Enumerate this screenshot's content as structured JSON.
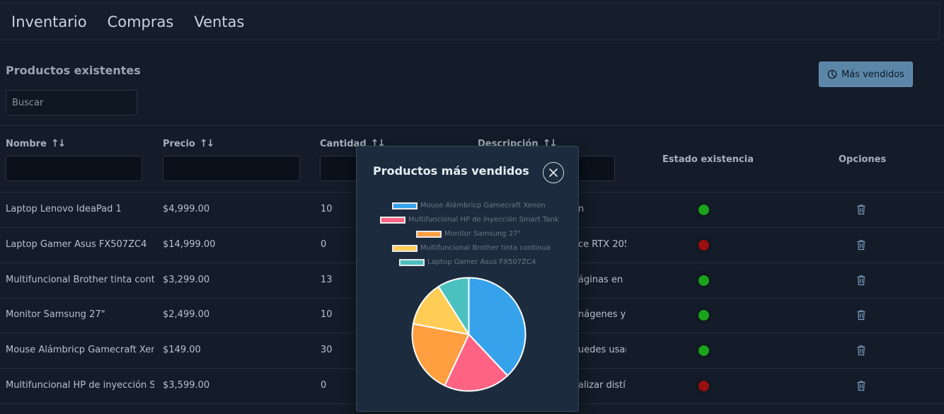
{
  "nav": {
    "items": [
      "Inventario",
      "Compras",
      "Ventas"
    ]
  },
  "page": {
    "title": "Productos existentes",
    "search_placeholder": "Buscar",
    "top_button": "Más vendidos"
  },
  "table": {
    "headers": [
      "Nombre",
      "Precio",
      "Cantidad",
      "Descripción",
      "Estado existencia",
      "Opciones"
    ],
    "rows": [
      {
        "name": "Laptop Lenovo IdeaPad 1",
        "price": "$4,999.00",
        "qty": "10",
        "desc": "n",
        "status": "green"
      },
      {
        "name": "Laptop Gamer Asus FX507ZC4",
        "price": "$14,999.00",
        "qty": "0",
        "desc": "ce RTX 205",
        "status": "red"
      },
      {
        "name": "Multifuncional Brother tinta cont",
        "price": "$3,299.00",
        "qty": "13",
        "desc": "áginas en (",
        "status": "green"
      },
      {
        "name": "Monitor Samsung 27\"",
        "price": "$2,499.00",
        "qty": "10",
        "desc": "nágenes y",
        "status": "green"
      },
      {
        "name": "Mouse Alámbricp Gamecraft Xen",
        "price": "$149.00",
        "qty": "30",
        "desc": "uedes usarl",
        "status": "green"
      },
      {
        "name": "Multifuncional HP de inyección S",
        "price": "$3,599.00",
        "qty": "0",
        "desc": "alizar distí",
        "status": "red"
      }
    ]
  },
  "modal": {
    "title": "Productos más vendidos"
  },
  "colors": {
    "green": "#1aa31a",
    "red": "#9a0f0f",
    "accent": "#5b86a8"
  },
  "chart_data": {
    "type": "pie",
    "categories": [
      "Mouse Alámbricp Gamecraft Xenon",
      "Multifuncional HP de inyección Smart Tank",
      "Monitor Samsung 27\"",
      "Multifuncional Brother tinta continua",
      "Laptop Gamer Asus FX507ZC4"
    ],
    "values": [
      38,
      19,
      21,
      13,
      9
    ],
    "colors": [
      "#36a2eb",
      "#ff6384",
      "#ff9f40",
      "#ffcd56",
      "#4bc0c0"
    ],
    "legend": "top"
  }
}
